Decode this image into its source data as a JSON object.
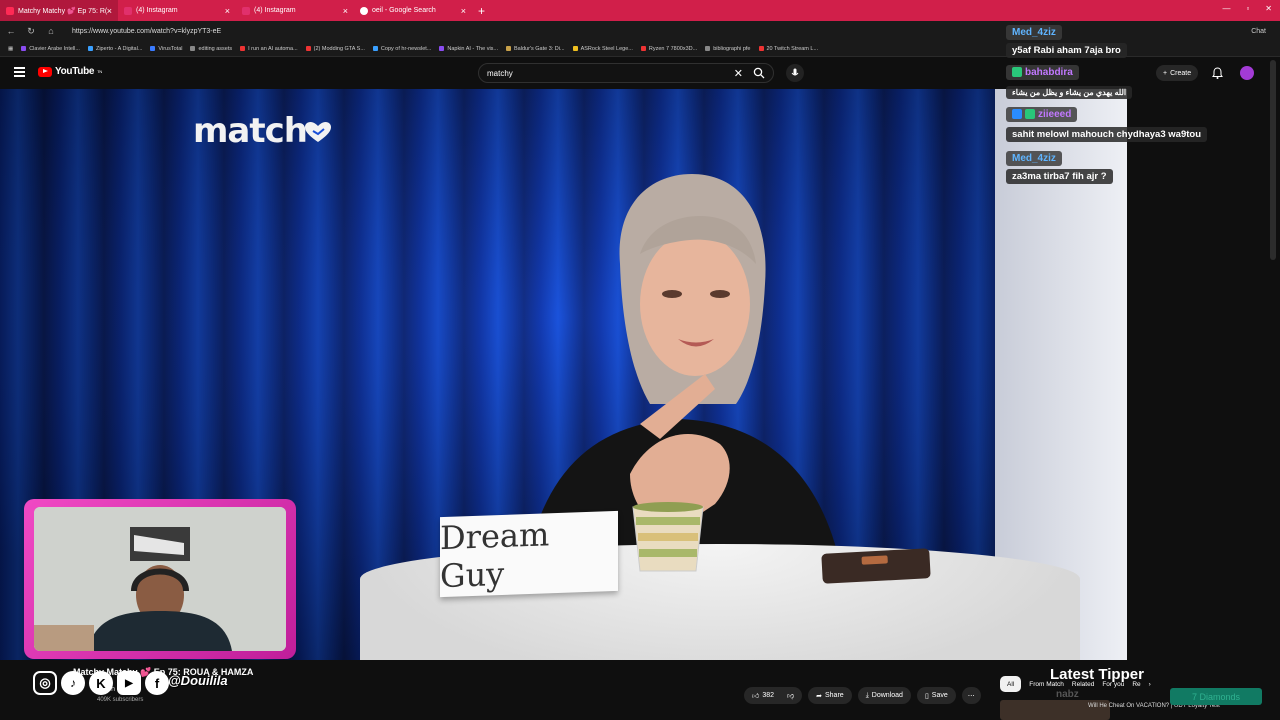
{
  "browser": {
    "tabs": [
      {
        "label": "Matchy Matchy 💕 Ep 75: R(",
        "color": "#ff2a55"
      },
      {
        "label": "(4) Instagram",
        "color": "#e1306c"
      },
      {
        "label": "(4) Instagram",
        "color": "#e1306c"
      },
      {
        "label": "oeil - Google Search",
        "color": "#ffffff"
      }
    ],
    "new_tab": "+",
    "url": "https://www.youtube.com/watch?v=klyzpYT3-eE",
    "bookmarks": [
      "Clavier Arabe Intell...",
      "Ziperto - A Digital...",
      "VirusTotal",
      "editing assets",
      "I run an AI automa...",
      "(2) Modding GTA S...",
      "Copy of hr-newslet...",
      "Napkin AI - The vis...",
      "Baldur's Gate 3: Di...",
      "ASRock Steel Lege...",
      "Ryzen 7 7800x3D...",
      "bibliographi pfe",
      "20 Twitch Stream L..."
    ],
    "chat_label": "Chat"
  },
  "youtube": {
    "logo_text": "YouTube",
    "logo_sup": "TN",
    "search_value": "matchy",
    "create_label": "Create",
    "accent": "#ff0000"
  },
  "video": {
    "brand_logo": "match",
    "nameplate": "Dream Guy",
    "title": "Matchy Matchy 💕 Ep 75: ROUA & HAMZA",
    "channel": "Match",
    "subscribers": "409K subscribers",
    "likes": "382",
    "share_label": "Share",
    "download_label": "Download",
    "save_label": "Save"
  },
  "overlay": {
    "social_handle": "@Douilila",
    "latest_tipper_label": "Latest Tipper",
    "tipper_name": "nabz",
    "diamonds": "7 Diamonds"
  },
  "chat": [
    {
      "user": "Med_4ziz",
      "text": "y5af Rabi aham 7aja bro",
      "color": "#5fb4ff"
    },
    {
      "user": "bahabdira",
      "text": "الله يهدي من يشاء و يظل من يشاء",
      "color": "#c178ff"
    },
    {
      "user": "ziieeed",
      "text": "sahit melowl mahouch chydhaya3 wa9tou",
      "color": "#c178ff"
    },
    {
      "user": "Med_4ziz",
      "text": "za3ma tirba7 fih ajr ?",
      "color": "#5fb4ff"
    }
  ],
  "filters": [
    "All",
    "From Match",
    "Related",
    "For you",
    "Re"
  ],
  "related_title": "Will He Cheat On VACATION? | UDY Loyalty Test"
}
